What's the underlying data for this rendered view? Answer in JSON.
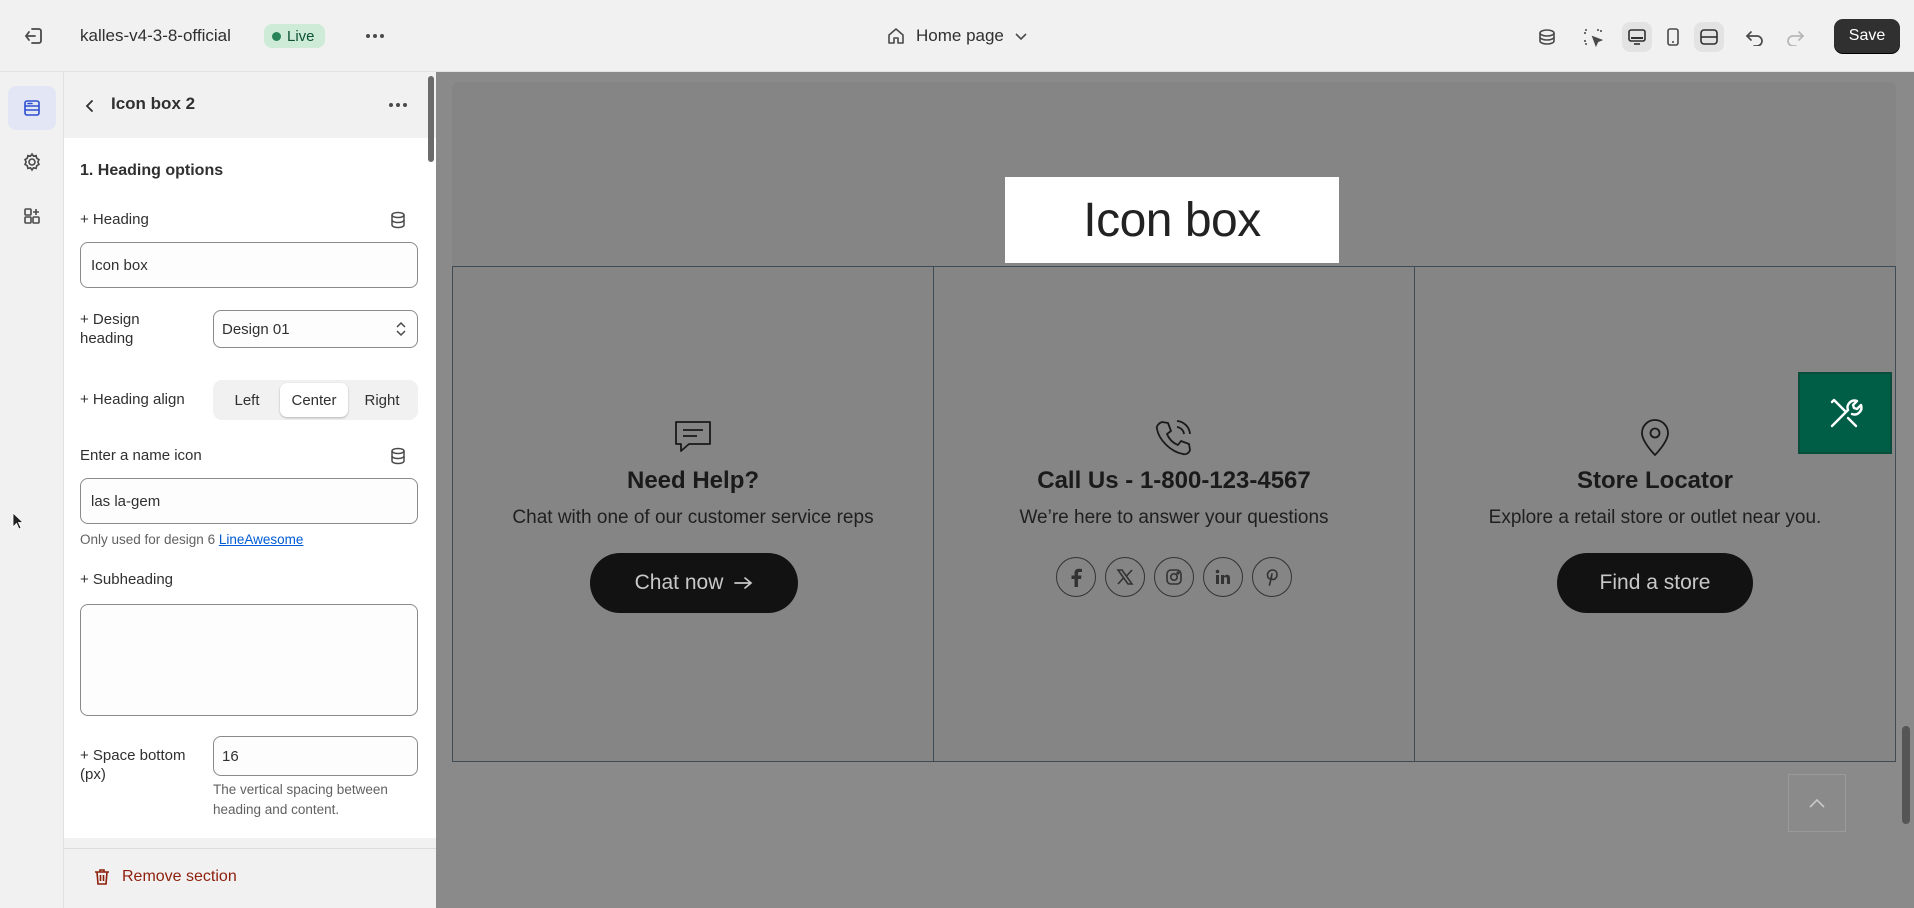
{
  "topbar": {
    "store_name": "kalles-v4-3-8-official",
    "status_badge": "Live",
    "page_selector": "Home page",
    "save_label": "Save",
    "tools": [
      "store-icon",
      "inspector-icon",
      "desktop-icon",
      "mobile-icon",
      "fullscreen-icon",
      "undo-icon",
      "redo-icon"
    ]
  },
  "rail": {
    "items": [
      "sections-icon",
      "settings-icon",
      "apps-icon"
    ]
  },
  "sidebar": {
    "title": "Icon box 2",
    "section_title": "1. Heading options",
    "heading": {
      "label": "+ Heading",
      "value": "Icon box"
    },
    "design_heading": {
      "label": "+ Design heading",
      "value": "Design 01"
    },
    "heading_align": {
      "label": "+ Heading align",
      "options": [
        "Left",
        "Center",
        "Right"
      ],
      "selected": "Center"
    },
    "name_icon": {
      "label": "Enter a name icon",
      "value": "las la-gem",
      "help_prefix": "Only used for design 6",
      "help_link": "LineAwesome"
    },
    "subheading": {
      "label": "+ Subheading",
      "value": ""
    },
    "space_bottom": {
      "label": "+ Space bottom (px)",
      "value": "16",
      "help": "The vertical spacing between heading and content."
    },
    "remove_label": "Remove section"
  },
  "preview": {
    "heading": "Icon box",
    "columns": [
      {
        "icon": "chat-icon",
        "title": "Need Help?",
        "desc": "Chat with one of our customer service reps",
        "button": "Chat now"
      },
      {
        "icon": "phone-icon",
        "title": "Call Us - 1-800-123-4567",
        "desc": "We’re here to answer your questions",
        "socials": [
          "facebook-icon",
          "x-icon",
          "instagram-icon",
          "linkedin-icon",
          "pinterest-icon"
        ]
      },
      {
        "icon": "map-pin-icon",
        "title": "Store Locator",
        "desc": "Explore a retail store or outlet near you.",
        "button": "Find a store"
      }
    ]
  },
  "colors": {
    "accent": "#005e46",
    "danger": "#8e1f0b",
    "link": "#005bd3",
    "live": "#29845a"
  }
}
